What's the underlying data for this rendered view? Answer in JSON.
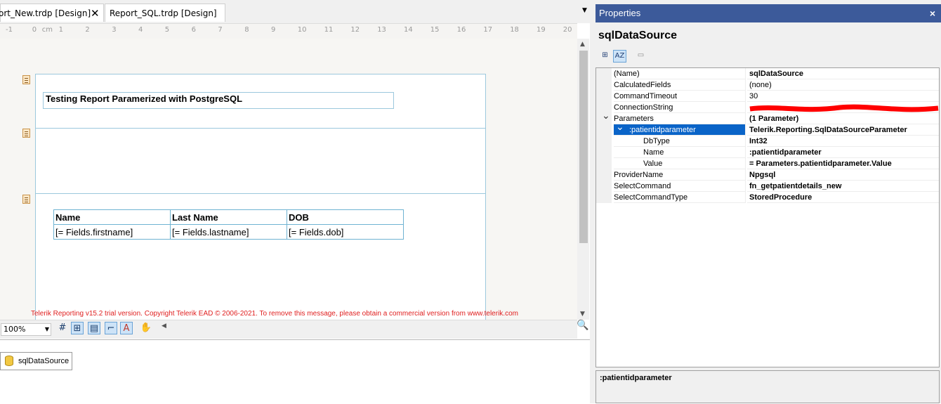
{
  "tabs": [
    {
      "label": "ort_New.trdp [Design]",
      "active": true,
      "close": "✕"
    },
    {
      "label": "Report_SQL.trdp [Design]",
      "active": false
    }
  ],
  "ruler": {
    "unit": "cm",
    "ticks": [
      "-1",
      "0",
      "1",
      "2",
      "3",
      "4",
      "5",
      "6",
      "7",
      "8",
      "9",
      "10",
      "11",
      "12",
      "13",
      "14",
      "15",
      "16",
      "17",
      "18",
      "19",
      "20"
    ]
  },
  "report": {
    "title": "Testing Report Paramerized with PostgreSQL",
    "table": {
      "headers": [
        "Name",
        "Last Name",
        "DOB"
      ],
      "row": [
        "[= Fields.firstname]",
        "[= Fields.lastname]",
        "[= Fields.dob]"
      ]
    },
    "trial_message": "Telerik Reporting v15.2 trial version. Copyright Telerik EAD © 2006-2021. To remove this message, please obtain a commercial version from www.telerik.com"
  },
  "toolbar": {
    "zoom": "100%"
  },
  "components": [
    {
      "label": "sqlDataSource",
      "icon": "database-icon"
    }
  ],
  "properties": {
    "header": "Properties",
    "close": "×",
    "object": "sqlDataSource",
    "rows": [
      {
        "name": "(Name)",
        "value": "sqlDataSource",
        "bold": true
      },
      {
        "name": "CalculatedFields",
        "value": "(none)",
        "bold": false
      },
      {
        "name": "CommandTimeout",
        "value": "30",
        "bold": false
      },
      {
        "name": "ConnectionString",
        "value": "",
        "bold": false,
        "redacted": true
      },
      {
        "name": "Parameters",
        "value": "(1 Parameter)",
        "bold": true,
        "expanded": true
      },
      {
        "name": ":patientidparameter",
        "value": "Telerik.Reporting.SqlDataSourceParameter",
        "bold": true,
        "expanded": true,
        "selected": true,
        "indent": 1
      },
      {
        "name": "DbType",
        "value": "Int32",
        "bold": true,
        "indent": 2
      },
      {
        "name": "Name",
        "value": ":patientidparameter",
        "bold": true,
        "indent": 2
      },
      {
        "name": "Value",
        "value": "= Parameters.patientidparameter.Value",
        "bold": true,
        "indent": 2
      },
      {
        "name": "ProviderName",
        "value": "Npgsql",
        "bold": true
      },
      {
        "name": "SelectCommand",
        "value": "fn_getpatientdetails_new",
        "bold": true
      },
      {
        "name": "SelectCommandType",
        "value": "StoredProcedure",
        "bold": true
      }
    ],
    "description_title": ":patientidparameter"
  },
  "colors": {
    "accent": "#3c5a9a",
    "selection": "#0a64c8",
    "section_line": "#9cc8dd",
    "trial_text": "#e02020"
  }
}
